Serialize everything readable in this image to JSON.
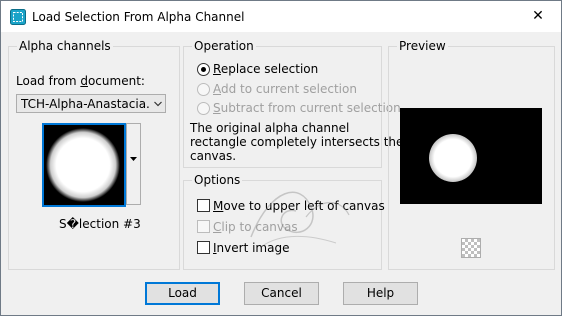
{
  "window": {
    "title": "Load Selection From Alpha Channel",
    "close_glyph": "✕"
  },
  "alpha_channels": {
    "title": "Alpha channels",
    "load_from_label_pre": "Load from ",
    "load_from_label_u": "d",
    "load_from_label_post": "ocument:",
    "document_value": "TCH-Alpha-Anastacia.psp",
    "selection_name": "S�lection #3"
  },
  "operation": {
    "title": "Operation",
    "options": [
      {
        "pre": "",
        "u": "R",
        "post": "eplace selection",
        "selected": true,
        "enabled": true
      },
      {
        "pre": "",
        "u": "A",
        "post": "dd to current selection",
        "selected": false,
        "enabled": false
      },
      {
        "pre": "",
        "u": "S",
        "post": "ubtract from current selection",
        "selected": false,
        "enabled": false
      }
    ],
    "info_line1": "The original alpha channel",
    "info_line2": "rectangle completely intersects the",
    "info_line3": "canvas."
  },
  "options": {
    "title": "Options",
    "items": [
      {
        "pre": "",
        "u": "M",
        "post": "ove to upper left of canvas",
        "checked": false,
        "enabled": true
      },
      {
        "pre": "",
        "u": "C",
        "post": "lip to canvas",
        "checked": false,
        "enabled": false
      },
      {
        "pre": "",
        "u": "I",
        "post": "nvert image",
        "checked": false,
        "enabled": true
      }
    ]
  },
  "preview": {
    "title": "Preview"
  },
  "buttons": {
    "load": "Load",
    "cancel": "Cancel",
    "help": "Help"
  },
  "colors": {
    "accent": "#0078d7",
    "disabled_text": "#a0a0a0",
    "dialog_bg": "#f0f0f0"
  },
  "icons": {
    "app": "selection-app-icon",
    "close": "close-icon",
    "dropdown": "chevron-down-icon",
    "thumb_menu": "triangle-down-icon",
    "transparency": "checkerboard-icon",
    "watermark": "watermark-logo"
  }
}
